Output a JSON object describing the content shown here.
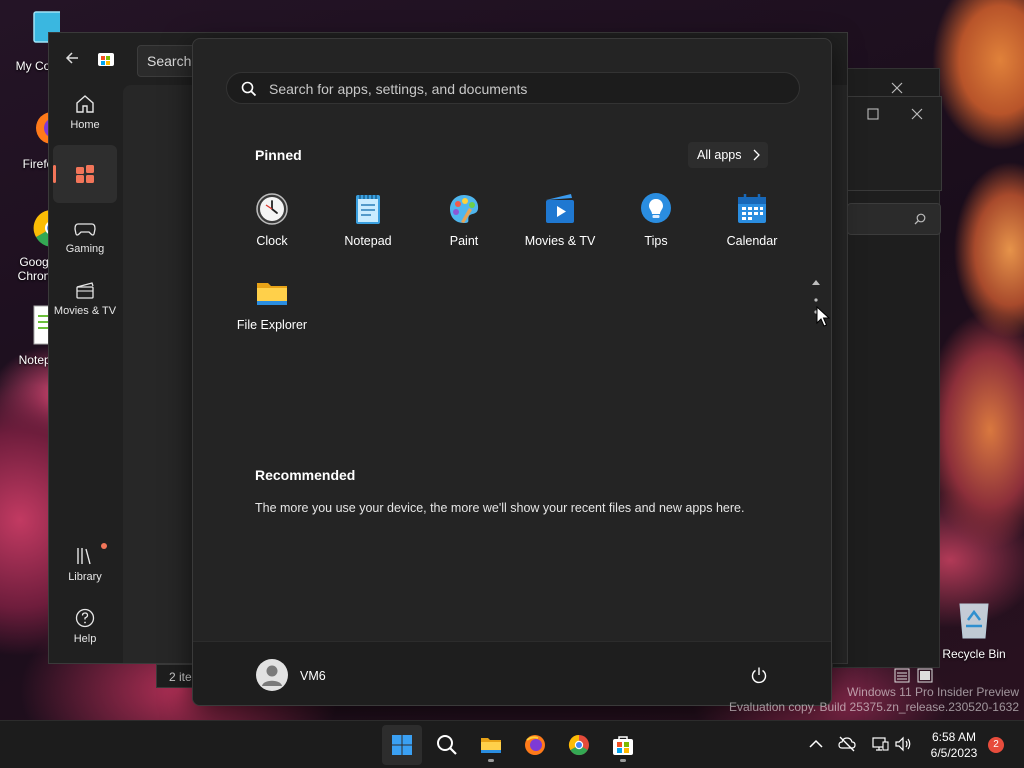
{
  "desktop": {
    "icons": [
      {
        "label": "My Com",
        "icon": "computer-icon"
      },
      {
        "label": "Firefo",
        "icon": "firefox-icon"
      },
      {
        "label": "Goog Chron",
        "icon": "chrome-icon"
      },
      {
        "label": "Notepa",
        "icon": "notepad-plus-icon"
      },
      {
        "label": "Recycle Bin",
        "icon": "recycle-bin-icon"
      }
    ],
    "watermark_line1": "Windows 11 Pro Insider Preview",
    "watermark_line2": "Evaluation copy. Build 25375.zn_release.230520-1632"
  },
  "store_window": {
    "search_text": "Search a",
    "nav": [
      {
        "label": "Home",
        "icon": "home-icon"
      },
      {
        "label": "",
        "icon": "apps-icon",
        "active": true
      },
      {
        "label": "Gaming",
        "icon": "gamepad-icon"
      },
      {
        "label": "Movies & TV",
        "icon": "clapperboard-icon"
      },
      {
        "label": "Library",
        "icon": "library-icon"
      },
      {
        "label": "Help",
        "icon": "help-icon"
      }
    ],
    "status_text": "2 ite"
  },
  "start_menu": {
    "search_placeholder": "Search for apps, settings, and documents",
    "pinned_title": "Pinned",
    "all_apps_label": "All apps",
    "pinned_apps": [
      {
        "label": "Clock",
        "icon": "clock-icon"
      },
      {
        "label": "Notepad",
        "icon": "notepad-icon"
      },
      {
        "label": "Paint",
        "icon": "paint-icon"
      },
      {
        "label": "Movies & TV",
        "icon": "movies-tv-icon"
      },
      {
        "label": "Tips",
        "icon": "tips-icon"
      },
      {
        "label": "Calendar",
        "icon": "calendar-icon"
      },
      {
        "label": "File Explorer",
        "icon": "file-explorer-icon"
      }
    ],
    "recommended_title": "Recommended",
    "recommended_text": "The more you use your device, the more we'll show your recent files and new apps here.",
    "user_name": "VM6"
  },
  "taskbar": {
    "apps": [
      "start-icon",
      "search-icon",
      "file-explorer-icon",
      "firefox-icon",
      "chrome-icon",
      "store-icon"
    ],
    "time": "6:58 AM",
    "date": "6/5/2023",
    "notification_count": "2"
  },
  "colors": {
    "accent": "#f27559",
    "menu_bg": "#242424",
    "taskbar_bg": "#1c1c1c",
    "win_blue": "#3aa0f3"
  }
}
